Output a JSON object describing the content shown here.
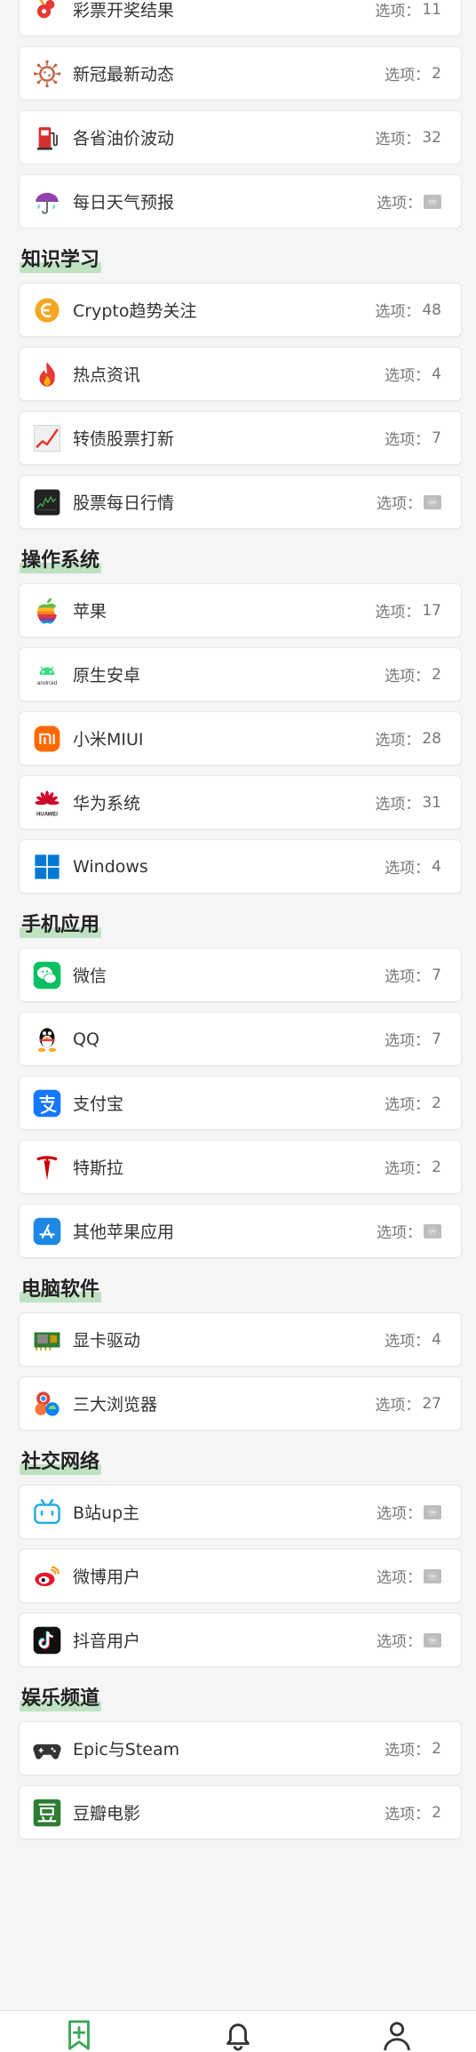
{
  "option_prefix": "选项：",
  "infinity_symbol": "♾",
  "sections": [
    {
      "title": "",
      "items": [
        {
          "label": "彩票开奖结果",
          "count": "11",
          "icon": "lottery-icon"
        },
        {
          "label": "新冠最新动态",
          "count": "2",
          "icon": "virus-icon"
        },
        {
          "label": "各省油价波动",
          "count": "32",
          "icon": "fuel-pump-icon"
        },
        {
          "label": "每日天气预报",
          "count": "♾",
          "icon": "weather-umbrella-icon"
        }
      ]
    },
    {
      "title": "知识学习",
      "items": [
        {
          "label": "Crypto趋势关注",
          "count": "48",
          "icon": "crypto-coin-icon"
        },
        {
          "label": "热点资讯",
          "count": "4",
          "icon": "fire-icon"
        },
        {
          "label": "转债股票打新",
          "count": "7",
          "icon": "trend-chart-icon"
        },
        {
          "label": "股票每日行情",
          "count": "♾",
          "icon": "stock-chart-icon"
        }
      ]
    },
    {
      "title": "操作系统",
      "items": [
        {
          "label": "苹果",
          "count": "17",
          "icon": "apple-logo-icon"
        },
        {
          "label": "原生安卓",
          "count": "2",
          "icon": "android-logo-icon"
        },
        {
          "label": "小米MIUI",
          "count": "28",
          "icon": "miui-logo-icon"
        },
        {
          "label": "华为系统",
          "count": "31",
          "icon": "huawei-logo-icon"
        },
        {
          "label": "Windows",
          "count": "4",
          "icon": "windows-logo-icon"
        }
      ]
    },
    {
      "title": "手机应用",
      "items": [
        {
          "label": "微信",
          "count": "7",
          "icon": "wechat-logo-icon"
        },
        {
          "label": "QQ",
          "count": "7",
          "icon": "qq-logo-icon"
        },
        {
          "label": "支付宝",
          "count": "2",
          "icon": "alipay-logo-icon"
        },
        {
          "label": "特斯拉",
          "count": "2",
          "icon": "tesla-logo-icon"
        },
        {
          "label": "其他苹果应用",
          "count": "♾",
          "icon": "app-store-icon"
        }
      ]
    },
    {
      "title": "电脑软件",
      "items": [
        {
          "label": "显卡驱动",
          "count": "4",
          "icon": "graphics-card-icon"
        },
        {
          "label": "三大浏览器",
          "count": "27",
          "icon": "browsers-icon"
        }
      ]
    },
    {
      "title": "社交网络",
      "items": [
        {
          "label": "B站up主",
          "count": "♾",
          "icon": "bilibili-logo-icon"
        },
        {
          "label": "微博用户",
          "count": "♾",
          "icon": "weibo-logo-icon"
        },
        {
          "label": "抖音用户",
          "count": "♾",
          "icon": "douyin-logo-icon"
        }
      ]
    },
    {
      "title": "娱乐频道",
      "items": [
        {
          "label": "Epic与Steam",
          "count": "2",
          "icon": "gamepad-icon"
        },
        {
          "label": "豆瓣电影",
          "count": "2",
          "icon": "douban-logo-icon"
        }
      ]
    }
  ],
  "tabbar": {
    "tabs": [
      {
        "icon": "bookmark-add-icon",
        "active": true,
        "color": "#3aa757"
      },
      {
        "icon": "bell-icon",
        "active": false,
        "color": "#333333"
      },
      {
        "icon": "user-icon",
        "active": false,
        "color": "#333333"
      }
    ]
  }
}
